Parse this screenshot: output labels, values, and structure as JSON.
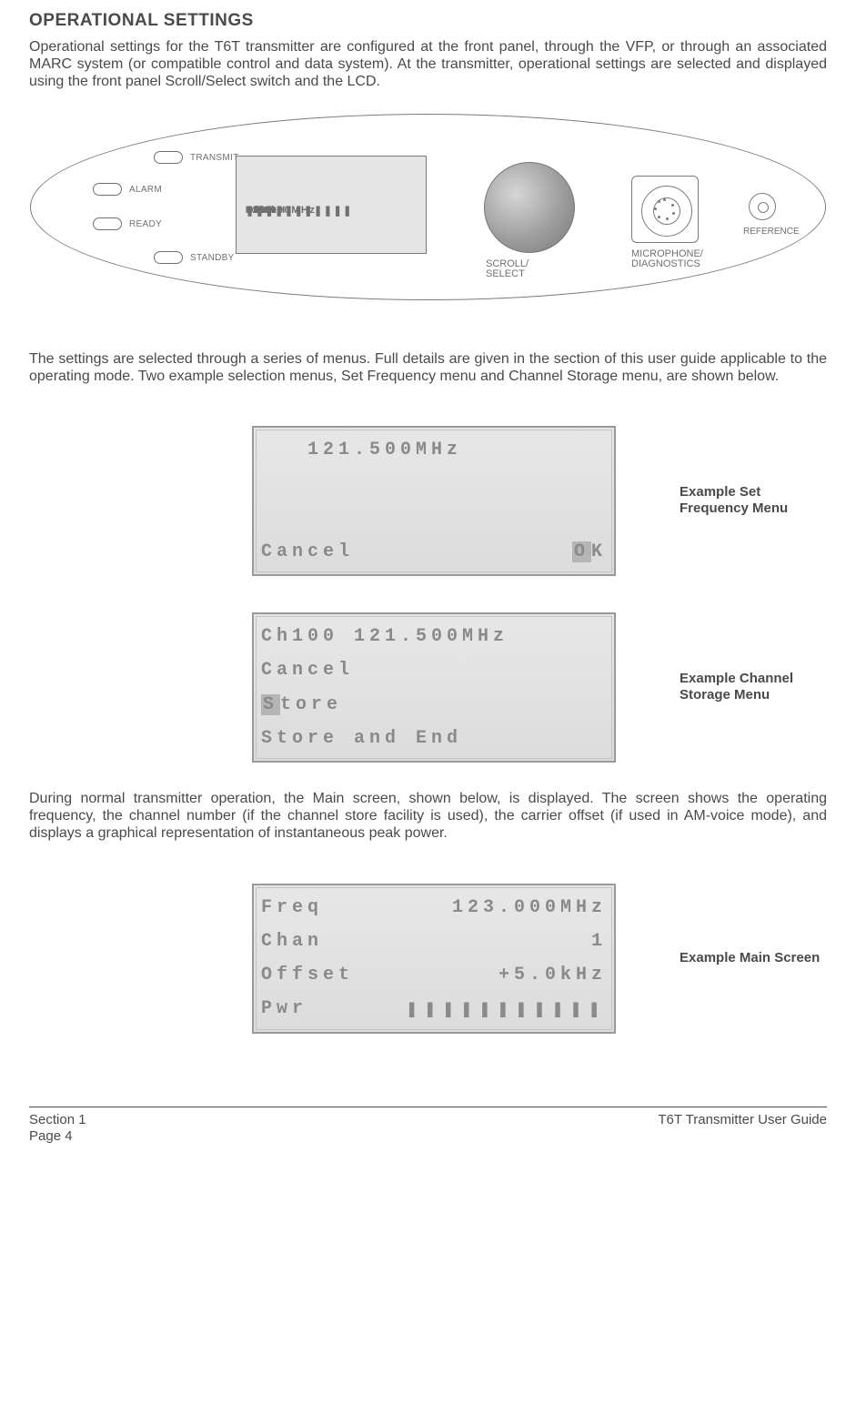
{
  "heading": "OPERATIONAL SETTINGS",
  "intro_para": "Operational settings for the T6T transmitter are configured at the front panel, through the VFP, or through an associated MARC system (or compatible control and data system). At the transmitter, operational settings are selected and displayed using the front panel Scroll/Select switch and the LCD.",
  "panel": {
    "leds": {
      "transmit": "TRANSMIT",
      "alarm": "ALARM",
      "ready": "READY",
      "standby": "STANDBY"
    },
    "lcd": {
      "l1_left": "Freq",
      "l1_right": "123.000MHz",
      "l2_left": "Chan",
      "l2_right": "1",
      "l3_left": "Offset",
      "l3_right": "+5.0kHz",
      "l4_left": "Pwr",
      "l4_right": "❚❚❚❚❚❚❚❚❚❚❚"
    },
    "knob_label_a": "SCROLL/",
    "knob_label_b": "SELECT",
    "jack_label_a": "MICROPHONE/",
    "jack_label_b": "DIAGNOSTICS",
    "ref_label": "REFERENCE"
  },
  "mid_para": "The settings are selected through a series of menus. Full details are given in the section of this user guide applicable to the operating mode. Two example selection menus, Set Frequency menu and Channel Storage menu, are shown below.",
  "ex1": {
    "line1": "   121.500MHz",
    "cancel": "Cancel",
    "ok_cursor": "O",
    "ok_rest": "K",
    "caption": "Example Set Frequency Menu"
  },
  "ex2": {
    "l1": "Ch100 121.500MHz",
    "l2": "Cancel",
    "l3_cursor": "S",
    "l3_rest": "tore",
    "l4": "Store and End",
    "caption": "Example Channel Storage Menu"
  },
  "after_para": "During normal transmitter operation, the Main screen, shown below, is displayed. The screen shows the operating frequency, the channel number (if the channel store facility is used), the carrier offset (if used in AM-voice mode), and displays a graphical representation of instantaneous peak power.",
  "ex3": {
    "l1_left": "Freq",
    "l1_right": "123.000MHz",
    "l2_left": "Chan",
    "l2_right": "1",
    "l3_left": "Offset",
    "l3_right": "+5.0kHz",
    "l4_left": "Pwr",
    "l4_right": "❚❚❚❚❚❚❚❚❚❚❚",
    "caption": "Example Main Screen"
  },
  "footer": {
    "section": "Section 1",
    "page": "Page 4",
    "doc_title": "T6T Transmitter User Guide"
  }
}
